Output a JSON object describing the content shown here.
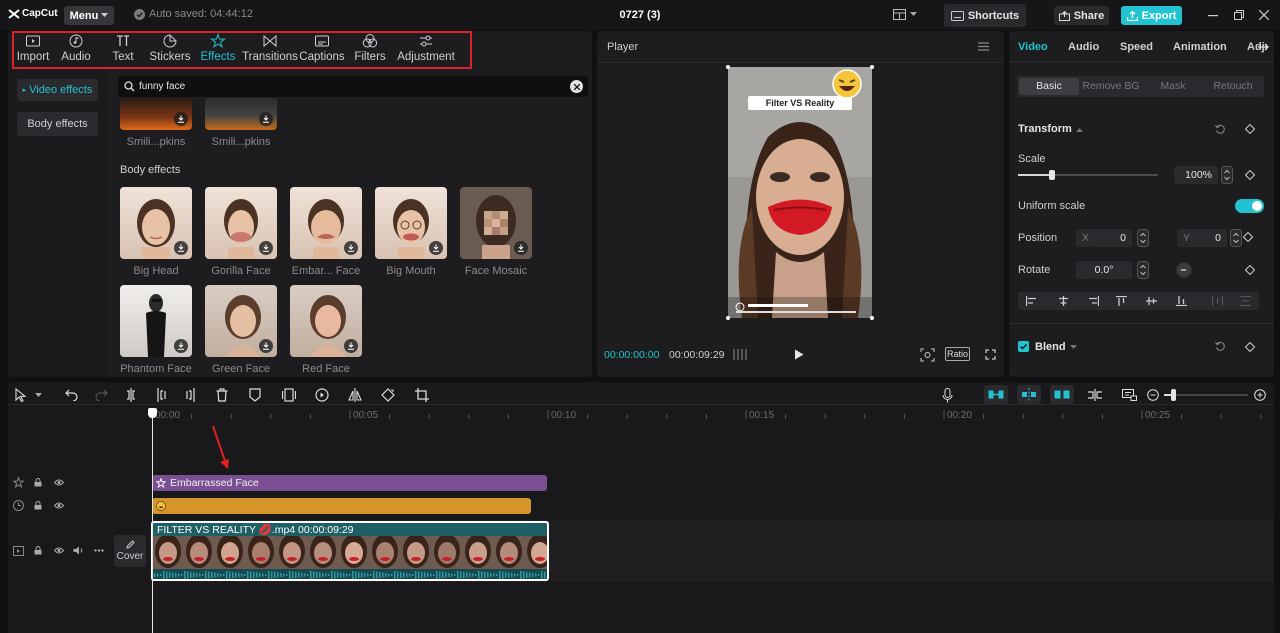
{
  "app": {
    "brand": "CapCut",
    "menu_label": "Menu",
    "autosave": "Auto saved: 04:44:12",
    "project_title": "0727 (3)"
  },
  "topbar": {
    "shortcuts": "Shortcuts",
    "share": "Share",
    "export": "Export"
  },
  "toolbar": {
    "tabs": [
      {
        "label": "Import",
        "icon": "import-icon"
      },
      {
        "label": "Audio",
        "icon": "audio-icon"
      },
      {
        "label": "Text",
        "icon": "text-icon"
      },
      {
        "label": "Stickers",
        "icon": "stickers-icon"
      },
      {
        "label": "Effects",
        "icon": "effects-icon",
        "active": true
      },
      {
        "label": "Transitions",
        "icon": "transitions-icon"
      },
      {
        "label": "Captions",
        "icon": "captions-icon"
      },
      {
        "label": "Filters",
        "icon": "filters-icon"
      },
      {
        "label": "Adjustment",
        "icon": "adjustment-icon"
      }
    ]
  },
  "effects_panel": {
    "nav": [
      {
        "label": "Video effects",
        "active": true
      },
      {
        "label": "Body effects"
      }
    ],
    "search_value": "funny face",
    "top_row_labels": [
      "Smili...pkins",
      "Smili...pkins"
    ],
    "section_title": "Body effects",
    "items": [
      {
        "label": "Big Head"
      },
      {
        "label": "Gorilla Face"
      },
      {
        "label": "Embar... Face"
      },
      {
        "label": "Big Mouth"
      },
      {
        "label": "Face Mosaic"
      },
      {
        "label": "Phantom Face"
      },
      {
        "label": "Green Face"
      },
      {
        "label": "Red Face"
      }
    ]
  },
  "player": {
    "title": "Player",
    "overlay_text": "Filter VS Reality",
    "current_time": "00:00:00:00",
    "total_time": "00:00:09:29",
    "ratio_label": "Ratio"
  },
  "inspector": {
    "tabs": [
      "Video",
      "Audio",
      "Speed",
      "Animation",
      "Adju"
    ],
    "subtabs": [
      "Basic",
      "Remove BG",
      "Mask",
      "Retouch"
    ],
    "transform_label": "Transform",
    "scale_label": "Scale",
    "scale_value": "100%",
    "scale_fraction": 0.24,
    "uniform_scale_label": "Uniform scale",
    "uniform_scale_on": true,
    "position_label": "Position",
    "pos_x_label": "X",
    "pos_x": "0",
    "pos_y_label": "Y",
    "pos_y": "0",
    "rotate_label": "Rotate",
    "rotate_value": "0.0°",
    "blend_label": "Blend"
  },
  "timeline": {
    "ruler": [
      "00:00",
      "00:05",
      "00:10",
      "00:15",
      "00:20",
      "00:25"
    ],
    "effect_clip_label": "Embarrassed Face",
    "video_clip_label": "FILTER VS REALITY 💋.mp4  00:00:09:29",
    "cover_label": "Cover",
    "colors": {
      "effect_clip": "#7a4f93",
      "sticker_clip": "#d6952a",
      "video_clip": "#1f5f66",
      "accent": "#20c3cf"
    }
  }
}
